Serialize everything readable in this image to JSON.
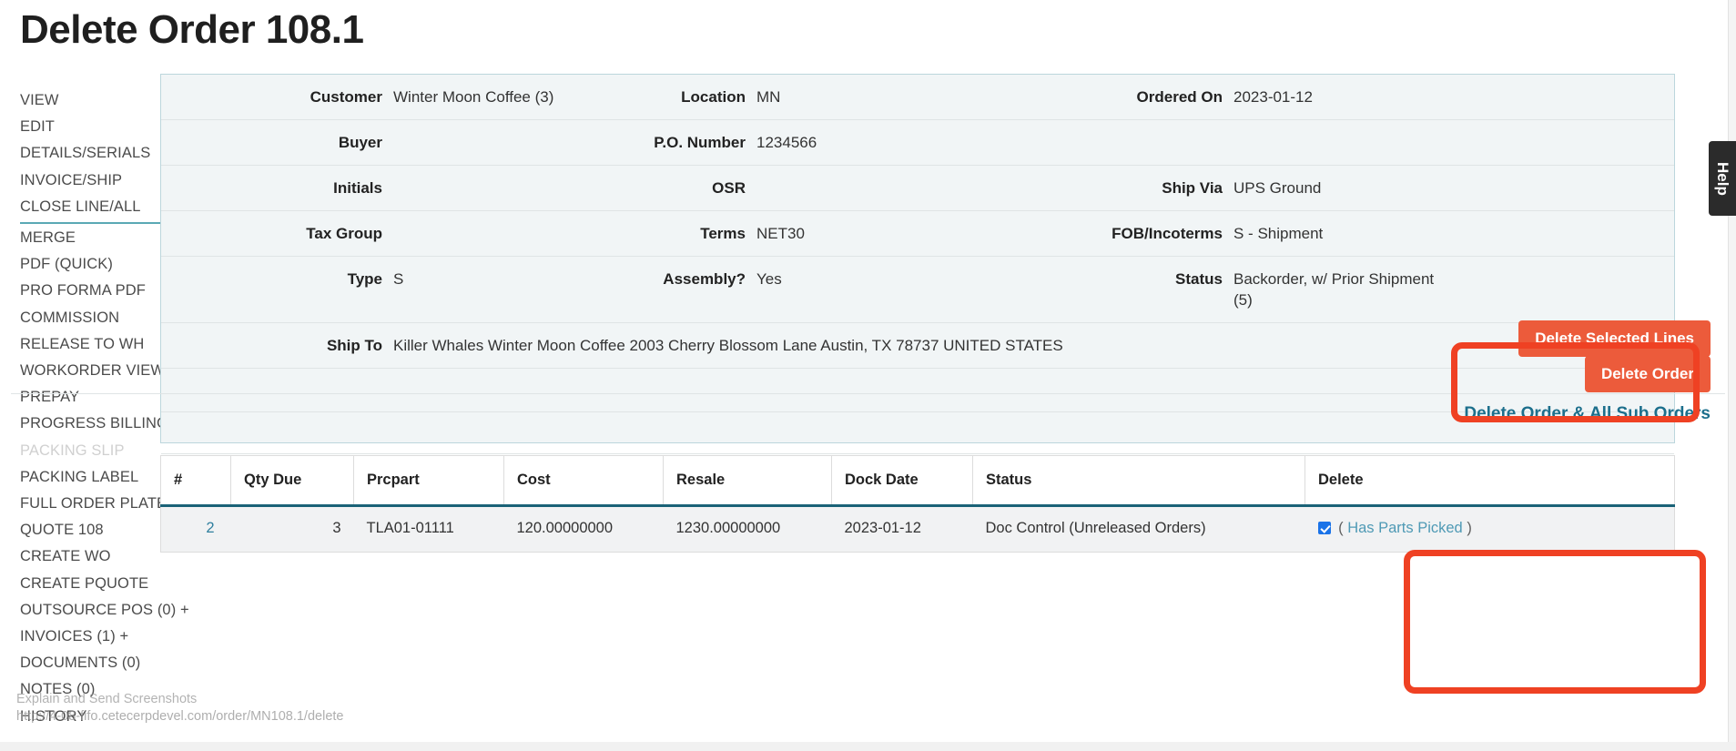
{
  "page": {
    "title": "Delete Order 108.1",
    "status_url": "http://4-08-fifo.cetecerpdevel.com/order/MN108.1/delete",
    "screenshot_hint": "Explain and Send Screenshots",
    "help_tab_label": "Help",
    "accent_teal": "#1a6277",
    "danger_color": "#ec5b3b",
    "link_color": "#1c6f8c",
    "annotation_color": "#ef4123"
  },
  "sidebar": {
    "items": [
      {
        "label": "VIEW",
        "disabled": false,
        "divider_after": false
      },
      {
        "label": "EDIT",
        "disabled": false,
        "divider_after": false
      },
      {
        "label": "DETAILS/SERIALS",
        "disabled": false,
        "divider_after": false
      },
      {
        "label": "INVOICE/SHIP",
        "disabled": false,
        "divider_after": false
      },
      {
        "label": "CLOSE LINE/ALL",
        "disabled": false,
        "divider_after": true
      },
      {
        "label": "MERGE",
        "disabled": false,
        "divider_after": false
      },
      {
        "label": "PDF (QUICK)",
        "disabled": false,
        "divider_after": false
      },
      {
        "label": "PRO FORMA PDF",
        "disabled": false,
        "divider_after": false
      },
      {
        "label": "COMMISSION",
        "disabled": false,
        "divider_after": false
      },
      {
        "label": "RELEASE TO WH",
        "disabled": false,
        "divider_after": false
      },
      {
        "label": "WORKORDER VIEW +",
        "disabled": false,
        "divider_after": false
      },
      {
        "label": "PREPAY",
        "disabled": false,
        "divider_after": false
      },
      {
        "label": "PROGRESS BILLING",
        "disabled": false,
        "divider_after": false
      },
      {
        "label": "PACKING SLIP",
        "disabled": true,
        "divider_after": false
      },
      {
        "label": "PACKING LABEL",
        "disabled": false,
        "divider_after": false
      },
      {
        "label": "FULL ORDER PLATE",
        "disabled": false,
        "divider_after": false
      },
      {
        "label": "QUOTE 108",
        "disabled": false,
        "divider_after": false
      },
      {
        "label": "CREATE WO",
        "disabled": false,
        "divider_after": false
      },
      {
        "label": "CREATE PQUOTE",
        "disabled": false,
        "divider_after": false
      },
      {
        "label": "OUTSOURCE POS (0) +",
        "disabled": false,
        "divider_after": false
      },
      {
        "label": "INVOICES (1) +",
        "disabled": false,
        "divider_after": false
      },
      {
        "label": "DOCUMENTS (0)",
        "disabled": false,
        "divider_after": false
      },
      {
        "label": "NOTES (0)",
        "disabled": false,
        "divider_after": false
      },
      {
        "label": "HISTORY",
        "disabled": false,
        "divider_after": false
      }
    ]
  },
  "order_info": {
    "customer_label": "Customer",
    "customer_value": "Winter Moon Coffee (3)",
    "location_label": "Location",
    "location_value": "MN",
    "ordered_on_label": "Ordered On",
    "ordered_on_value": "2023-01-12",
    "buyer_label": "Buyer",
    "buyer_value": "",
    "po_number_label": "P.O. Number",
    "po_number_value": "1234566",
    "blank_right_1": "",
    "initials_label": "Initials",
    "initials_value": "",
    "osr_label": "OSR",
    "osr_value": "",
    "ship_via_label": "Ship Via",
    "ship_via_value": "UPS Ground",
    "tax_group_label": "Tax Group",
    "tax_group_value": "",
    "terms_label": "Terms",
    "terms_value": "NET30",
    "fob_label": "FOB/Incoterms",
    "fob_value": "S - Shipment",
    "type_label": "Type",
    "type_value": "S",
    "assembly_label": "Assembly?",
    "assembly_value": "Yes",
    "status_label": "Status",
    "status_value": "Backorder, w/ Prior Shipment (5)",
    "ship_to_label": "Ship To",
    "ship_to_value": "Killer Whales Winter Moon Coffee 2003 Cherry Blossom Lane Austin, TX 78737 UNITED STATES"
  },
  "actions": {
    "delete_selected_lines": "Delete Selected Lines",
    "delete_order": "Delete Order",
    "delete_order_all_sub_orders": "Delete Order & All Sub Orders"
  },
  "lines_table": {
    "columns": [
      "#",
      "Qty Due",
      "Prcpart",
      "Cost",
      "Resale",
      "Dock Date",
      "Status",
      "Delete"
    ],
    "rows": [
      {
        "index": "2",
        "qty_due": "3",
        "prcpart": "TLA01-01111",
        "cost": "120.00000000",
        "resale": "1230.00000000",
        "dock_date": "2023-01-12",
        "status": "Doc Control (Unreleased Orders)",
        "delete_checked": true,
        "delete_open_paren": "(",
        "delete_note": "Has Parts Picked",
        "delete_close_paren": ")"
      }
    ]
  }
}
